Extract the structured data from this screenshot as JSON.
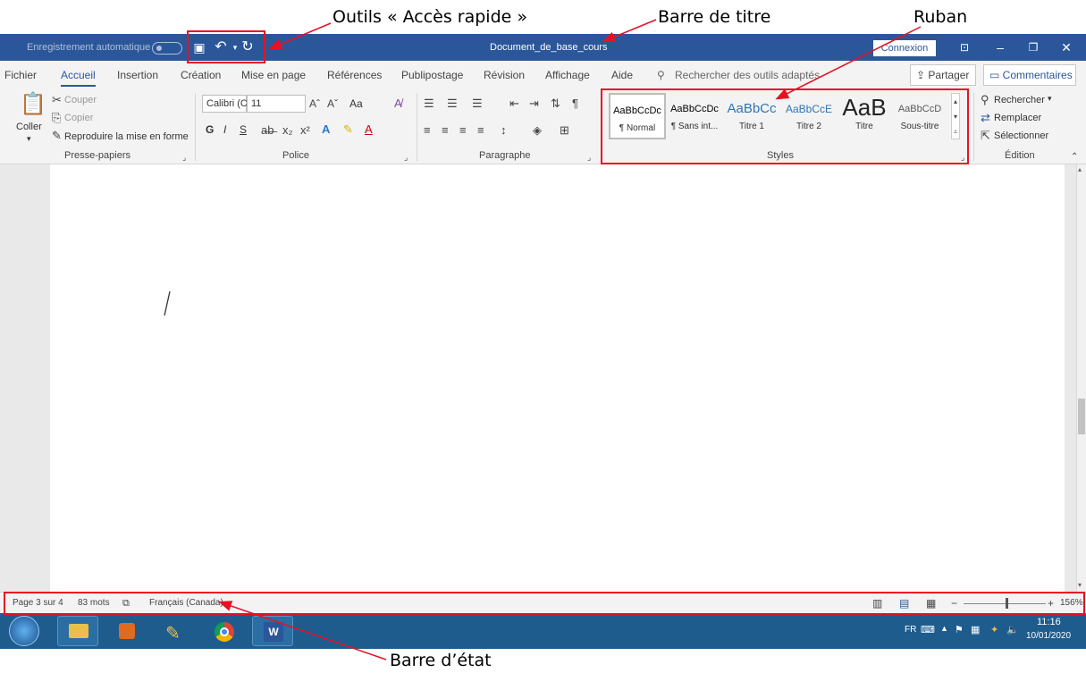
{
  "annotations": {
    "quick_access": "Outils « Accès rapide »",
    "title_bar": "Barre de titre",
    "ribbon": "Ruban",
    "status_bar": "Barre d’état"
  },
  "titlebar": {
    "autosave": "Enregistrement automatique",
    "document_title": "Document_de_base_cours",
    "sign_in": "Connexion"
  },
  "tabs": {
    "items": [
      "Fichier",
      "Accueil",
      "Insertion",
      "Création",
      "Mise en page",
      "Références",
      "Publipostage",
      "Révision",
      "Affichage",
      "Aide"
    ],
    "active": "Accueil",
    "search": "Rechercher des outils adaptés",
    "share": "Partager",
    "comments": "Commentaires"
  },
  "ribbon": {
    "clipboard": {
      "paste": "Coller",
      "cut": "Couper",
      "copy": "Copier",
      "format_painter": "Reproduire la mise en forme",
      "group_label": "Presse-papiers"
    },
    "font": {
      "font_name": "Calibri (Corp",
      "font_size": "11",
      "change_case": "Aa",
      "bold": "G",
      "italic": "I",
      "underline": "S",
      "group_label": "Police"
    },
    "paragraph": {
      "group_label": "Paragraphe"
    },
    "styles": {
      "items": [
        {
          "preview": "AaBbCcDc",
          "name": "¶ Normal"
        },
        {
          "preview": "AaBbCcDc",
          "name": "¶ Sans int..."
        },
        {
          "preview": "AaBbCc",
          "name": "Titre 1"
        },
        {
          "preview": "AaBbCcE",
          "name": "Titre 2"
        },
        {
          "preview": "AaB",
          "name": "Titre"
        },
        {
          "preview": "AaBbCcD",
          "name": "Sous-titre"
        }
      ],
      "group_label": "Styles"
    },
    "editing": {
      "find": "Rechercher",
      "replace": "Remplacer",
      "select": "Sélectionner",
      "group_label": "Édition"
    }
  },
  "status": {
    "page": "Page 3 sur 4",
    "words": "83 mots",
    "language": "Français (Canada)",
    "zoom": "156%"
  },
  "tray": {
    "lang": "FR",
    "time": "11:16",
    "date": "10/01/2020"
  },
  "colors": {
    "word_blue": "#2b579a",
    "annotation_red": "#e81123",
    "taskbar": "#1e5c8e"
  }
}
